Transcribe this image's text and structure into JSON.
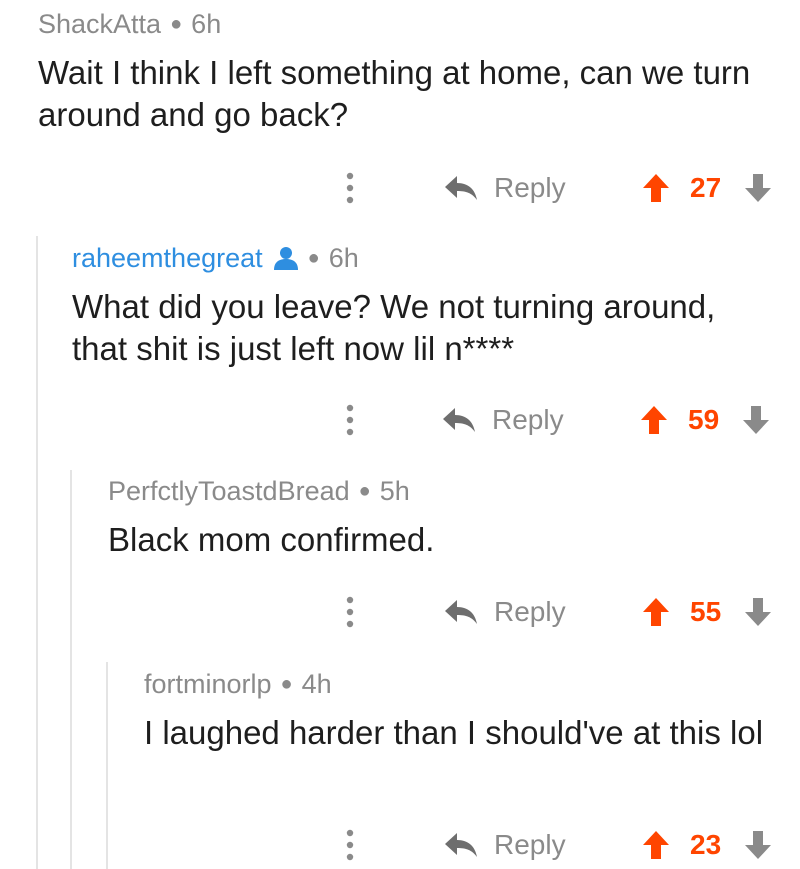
{
  "comments": [
    {
      "author": "ShackAtta",
      "time": "6h",
      "text": "Wait I think I left something at home, can we turn around and go back?",
      "reply_label": "Reply",
      "score": "27"
    },
    {
      "author": "raheemthegreat",
      "time": "6h",
      "text": "What did you leave? We not turning around, that shit is just left now lil n****",
      "reply_label": "Reply",
      "score": "59"
    },
    {
      "author": "PerfctlyToastdBread",
      "time": "5h",
      "text": "Black mom confirmed.",
      "reply_label": "Reply",
      "score": "55"
    },
    {
      "author": "fortminorlp",
      "time": "4h",
      "text": "I laughed harder than I should've at this lol",
      "reply_label": "Reply",
      "score": "23"
    }
  ],
  "colors": {
    "upvote": "#ff4500",
    "op_author": "#2e8ee0",
    "meta": "#8a8a8a"
  },
  "icons": {
    "more": "more-vertical-icon",
    "reply": "reply-arrow-icon",
    "upvote": "upvote-arrow-icon",
    "downvote": "downvote-arrow-icon",
    "op": "user-icon"
  }
}
